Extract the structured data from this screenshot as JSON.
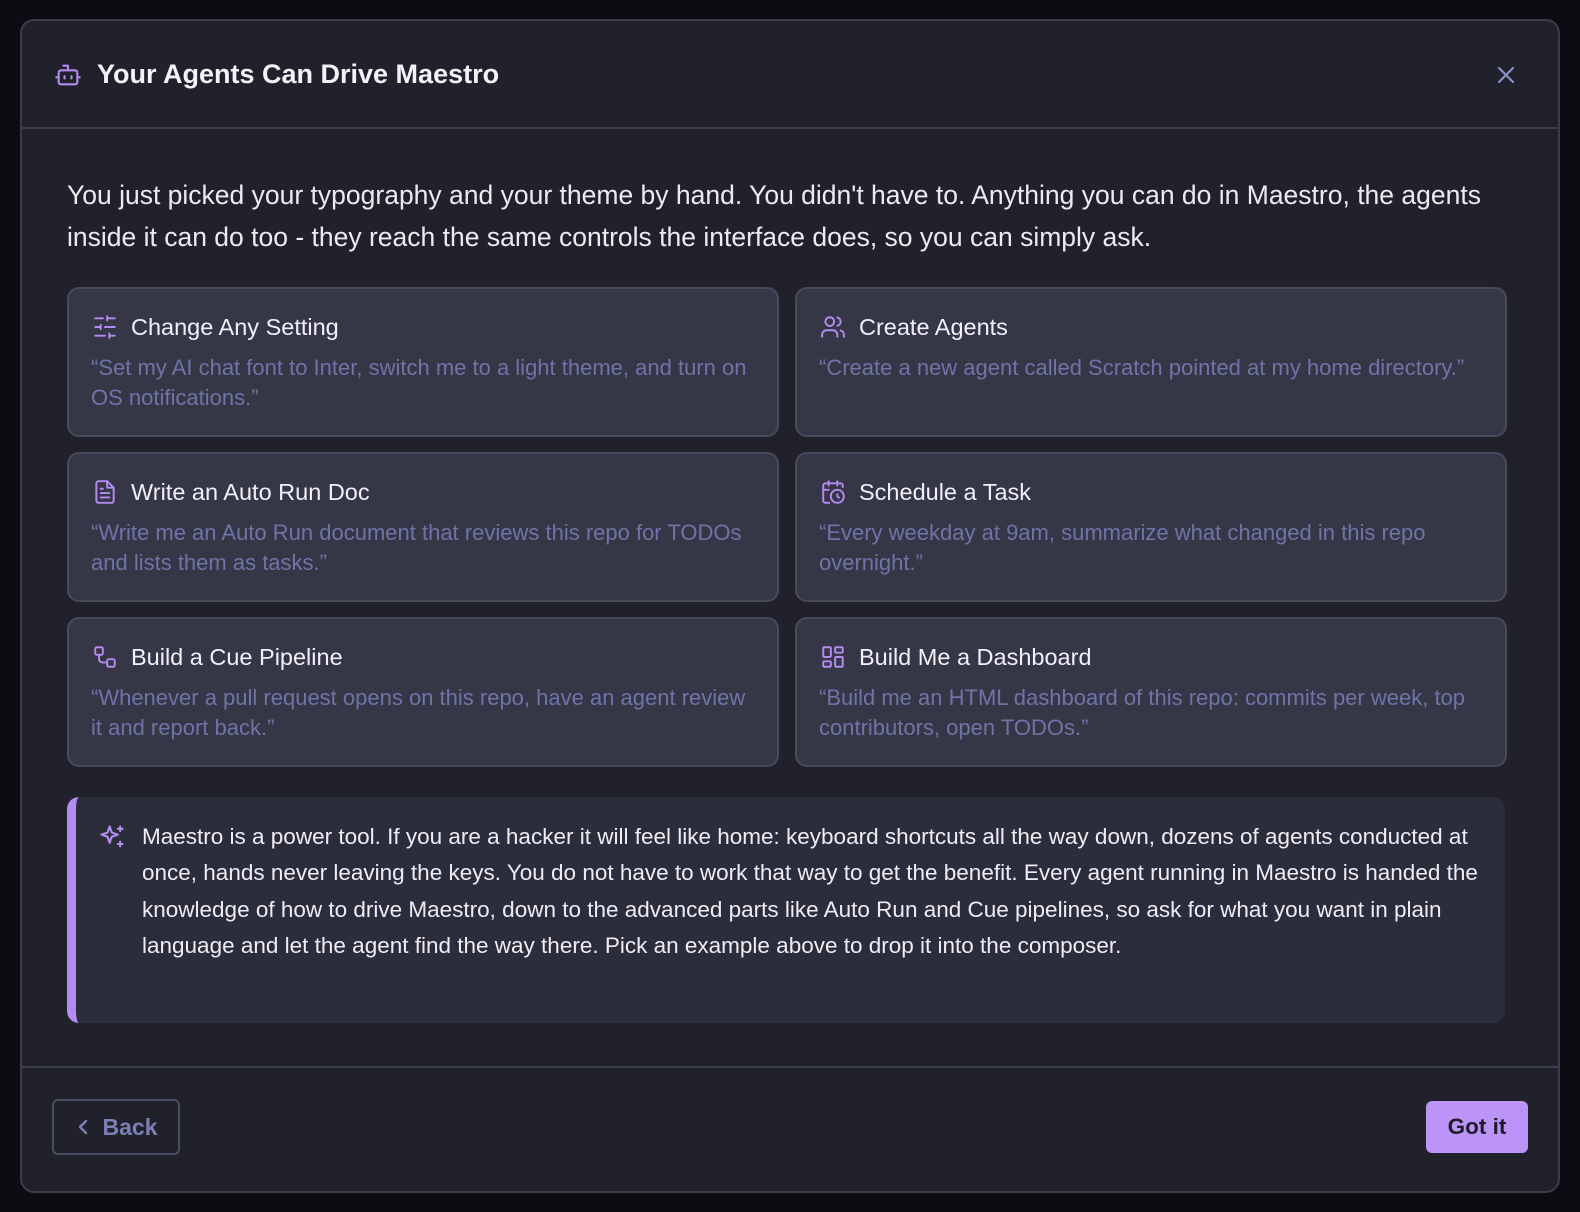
{
  "colors": {
    "accent": "#bc93f6",
    "icon_accent": "#b48cf0",
    "muted_text": "#6f74a8",
    "background": "#21212c"
  },
  "dialog": {
    "title": "Your Agents Can Drive Maestro",
    "title_icon": "robot-icon",
    "close_icon": "close-icon",
    "intro": "You just picked your typography and your theme by hand. You didn't have to. Anything you can do in Maestro, the agents inside it can do too - they reach the same controls the interface does, so you can simply ask."
  },
  "cards": [
    {
      "icon": "sliders-icon",
      "title": "Change Any Setting",
      "text": "“Set my AI chat font to Inter, switch me to a light theme, and turn on OS notifications.”"
    },
    {
      "icon": "users-icon",
      "title": "Create Agents",
      "text": "“Create a new agent called Scratch pointed at my home directory.”"
    },
    {
      "icon": "document-icon",
      "title": "Write an Auto Run Doc",
      "text": "“Write me an Auto Run document that reviews this repo for TODOs and lists them as tasks.”"
    },
    {
      "icon": "calendar-clock-icon",
      "title": "Schedule a Task",
      "text": "“Every weekday at 9am, summarize what changed in this repo overnight.”"
    },
    {
      "icon": "pipeline-icon",
      "title": "Build a Cue Pipeline",
      "text": "“Whenever a pull request opens on this repo, have an agent review it and report back.”"
    },
    {
      "icon": "dashboard-icon",
      "title": "Build Me a Dashboard",
      "text": "“Build me an HTML dashboard of this repo: commits per week, top contributors, open TODOs.”"
    }
  ],
  "note": {
    "icon": "sparkles-icon",
    "text": "Maestro is a power tool. If you are a hacker it will feel like home: keyboard shortcuts all the way down, dozens of agents conducted at once, hands never leaving the keys. You do not have to work that way to get the benefit. Every agent running in Maestro is handed the knowledge of how to drive Maestro, down to the advanced parts like Auto Run and Cue pipelines, so ask for what you want in plain language and let the agent find the way there. Pick an example above to drop it into the composer."
  },
  "footer": {
    "back_label": "Back",
    "back_icon": "chevron-left-icon",
    "primary_label": "Got it"
  }
}
